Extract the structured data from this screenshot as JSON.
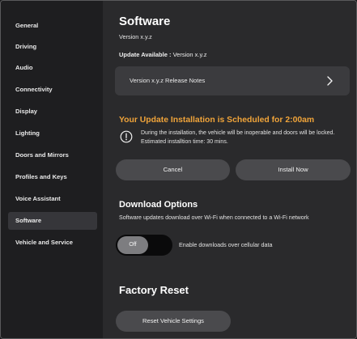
{
  "sidebar": {
    "items": [
      {
        "label": "General",
        "active": false
      },
      {
        "label": "Driving",
        "active": false
      },
      {
        "label": "Audio",
        "active": false
      },
      {
        "label": "Connectivity",
        "active": false
      },
      {
        "label": "Display",
        "active": false
      },
      {
        "label": "Lighting",
        "active": false
      },
      {
        "label": "Doors and Mirrors",
        "active": false
      },
      {
        "label": "Profiles and Keys",
        "active": false
      },
      {
        "label": "Voice Assistant",
        "active": false
      },
      {
        "label": "Software",
        "active": true
      },
      {
        "label": "Vehicle and Service",
        "active": false
      }
    ]
  },
  "main": {
    "title": "Software",
    "version": "Version x.y.z",
    "update_available_label": "Update Available :",
    "update_available_version": "Version x.y.z",
    "release_notes_label": "Version x.y.z Release Notes",
    "schedule_title": "Your Update Installation is Scheduled for 2:00am",
    "schedule_info": "During the installation, the vehicle will be inoperable and doors will be locked. Estimated installtion time: 30 mins.",
    "cancel_label": "Cancel",
    "install_label": "Install Now",
    "download_title": "Download Options",
    "download_desc": "Software updates download over Wi-Fi when connected to a Wi-Fi network",
    "toggle_state": "Off",
    "toggle_label": "Enable downloads over cellular data",
    "factory_title": "Factory Reset",
    "reset_label": "Reset Vehicle Settings"
  },
  "colors": {
    "accent": "#f0a43a",
    "background": "#2a2a2c",
    "sidebar": "#1e1e20",
    "button": "#4a4a4d"
  },
  "icons": {
    "release_chevron": "chevron-right-icon",
    "info": "info-icon"
  }
}
